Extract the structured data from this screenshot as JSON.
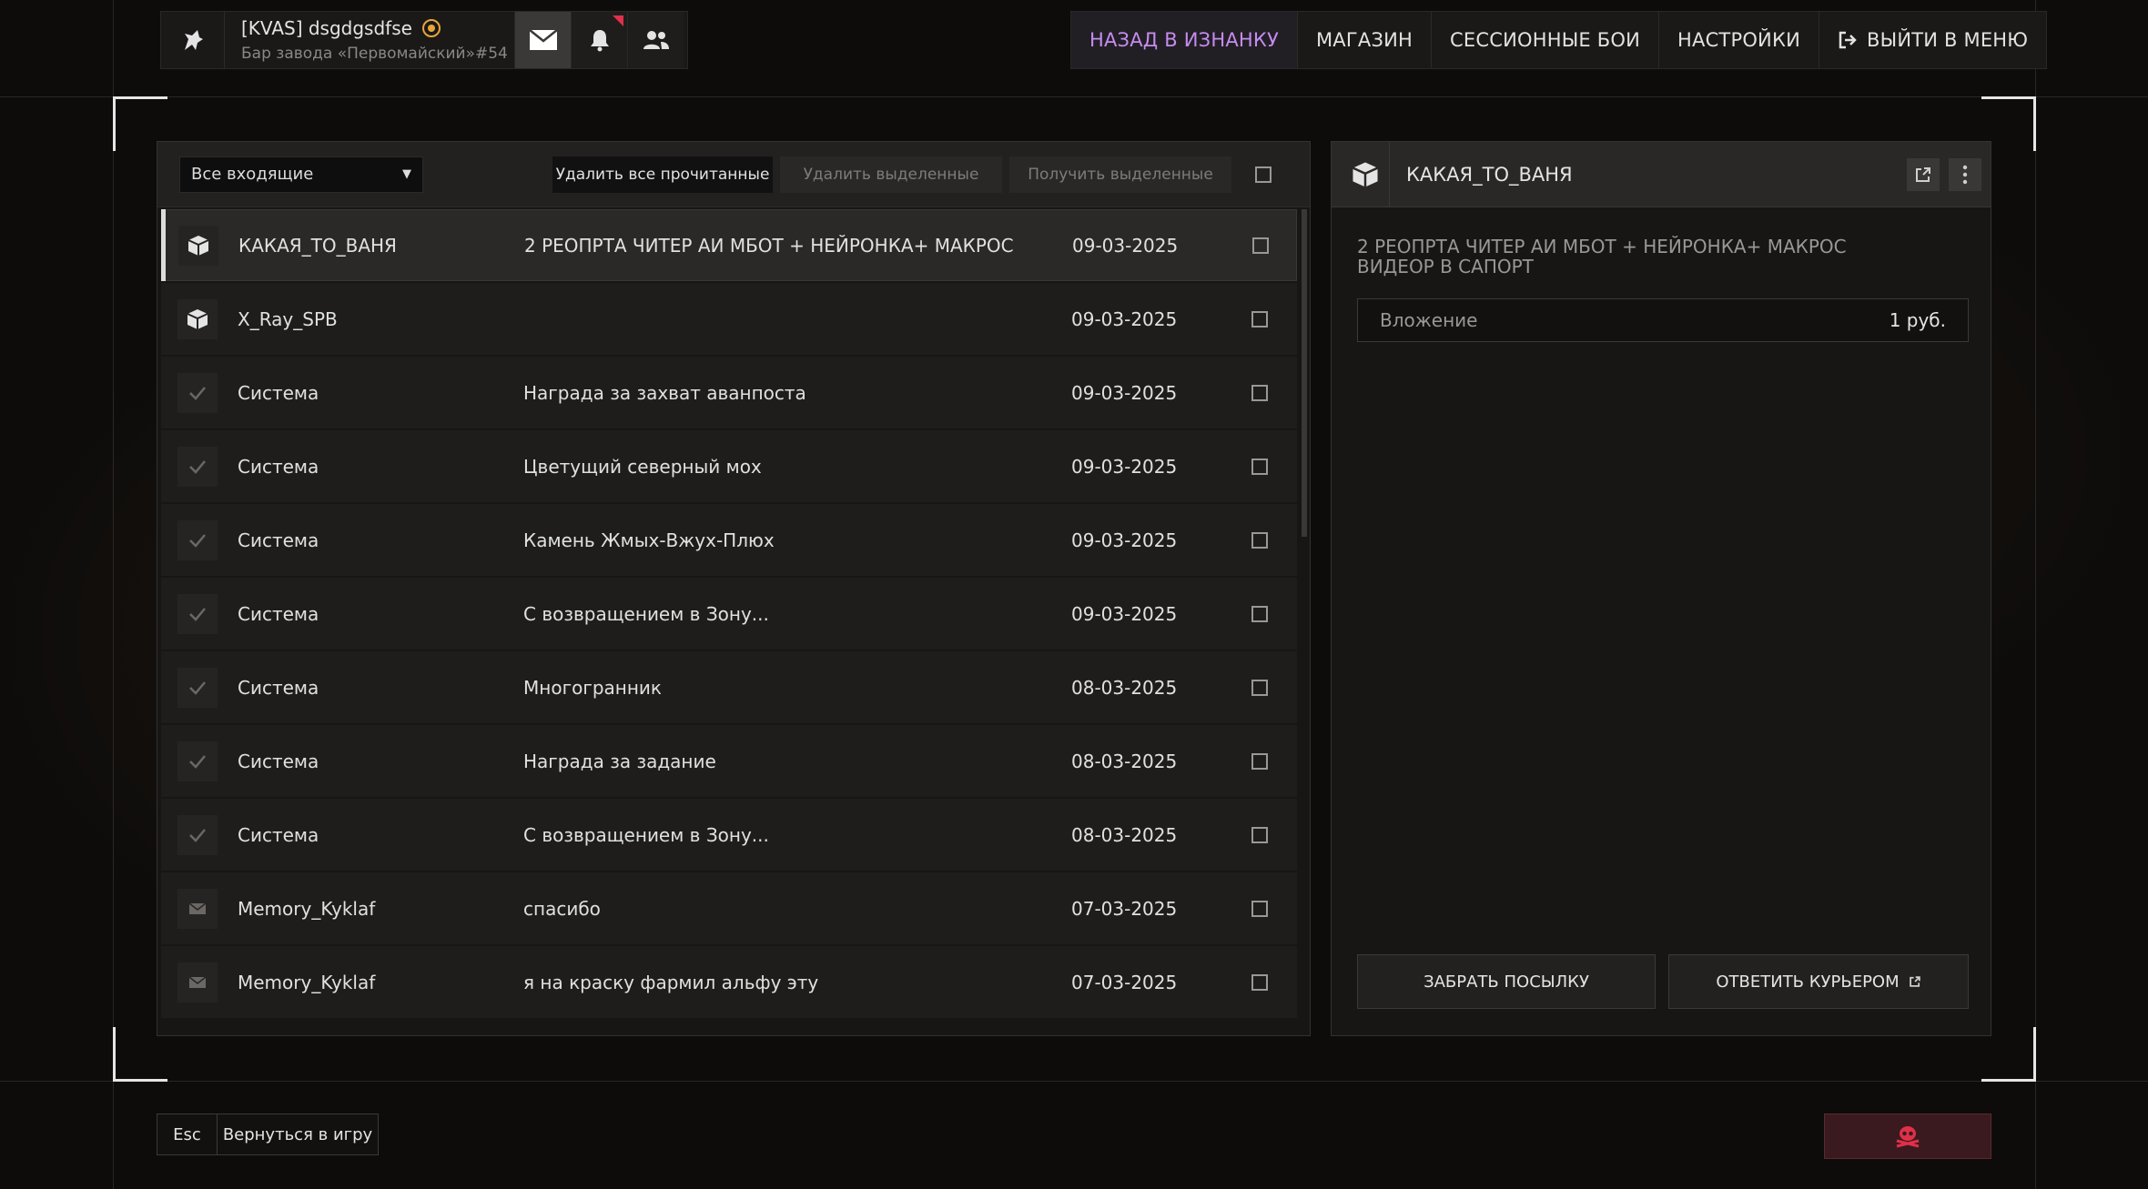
{
  "profile": {
    "name": "[KVAS] dsgdgsdfse",
    "location": "Бар завода «Первомайский»#54"
  },
  "topnav": {
    "back": "НАЗАД В ИЗНАНКУ",
    "shop": "МАГАЗИН",
    "session_battles": "СЕССИОННЫЕ БОИ",
    "settings": "НАСТРОЙКИ",
    "exit": "ВЫЙТИ В МЕНЮ"
  },
  "toolbar": {
    "filter_value": "Все входящие",
    "delete_read": "Удалить все прочитанные",
    "delete_selected": "Удалить выделенные",
    "get_selected": "Получить выделенные"
  },
  "mails": [
    {
      "icon": "package-icon",
      "sender": "КАКАЯ_ТО_ВАНЯ",
      "subject": "2 РЕОПРТА ЧИТЕР АИ МБОТ + НЕЙРОНКА+ МАКРОС",
      "date": "09-03-2025",
      "selected": true
    },
    {
      "icon": "package-icon",
      "sender": "X_Ray_SPB",
      "subject": "",
      "date": "09-03-2025"
    },
    {
      "icon": "check-icon",
      "sender": "Система",
      "subject": "Награда за захват аванпоста",
      "date": "09-03-2025"
    },
    {
      "icon": "check-icon",
      "sender": "Система",
      "subject": "Цветущий северный мох",
      "date": "09-03-2025"
    },
    {
      "icon": "check-icon",
      "sender": "Система",
      "subject": "Камень Жмых-Вжух-Плюх",
      "date": "09-03-2025"
    },
    {
      "icon": "check-icon",
      "sender": "Система",
      "subject": "С возвращением в Зону...",
      "date": "09-03-2025"
    },
    {
      "icon": "check-icon",
      "sender": "Система",
      "subject": "Многогранник",
      "date": "08-03-2025"
    },
    {
      "icon": "check-icon",
      "sender": "Система",
      "subject": "Награда за задание",
      "date": "08-03-2025"
    },
    {
      "icon": "check-icon",
      "sender": "Система",
      "subject": "С возвращением в Зону...",
      "date": "08-03-2025"
    },
    {
      "icon": "envelope-icon",
      "sender": "Memory_Kyklaf",
      "subject": "спасибо",
      "date": "07-03-2025"
    },
    {
      "icon": "envelope-icon",
      "sender": "Memory_Kyklaf",
      "subject": "я на краску фармил альфу эту",
      "date": "07-03-2025"
    }
  ],
  "message": {
    "sender": "КАКАЯ_ТО_ВАНЯ",
    "body_line1": "2 РЕОПРТА ЧИТЕР АИ МБОТ + НЕЙРОНКА+ МАКРОС",
    "body_line2": "ВИДЕОР В САПОРТ",
    "attachment_label": "Вложение",
    "attachment_value": "1 руб.",
    "take_parcel": "ЗАБРАТЬ ПОСЫЛКУ",
    "reply_courier": "ОТВЕТИТЬ КУРЬЕРОМ"
  },
  "bottom": {
    "esc_key": "Esc",
    "return_label": "Вернуться в игру"
  },
  "colors": {
    "accent_purple": "#c58cf0",
    "notif_red": "#e0304a",
    "skull_red": "#e0304a"
  }
}
